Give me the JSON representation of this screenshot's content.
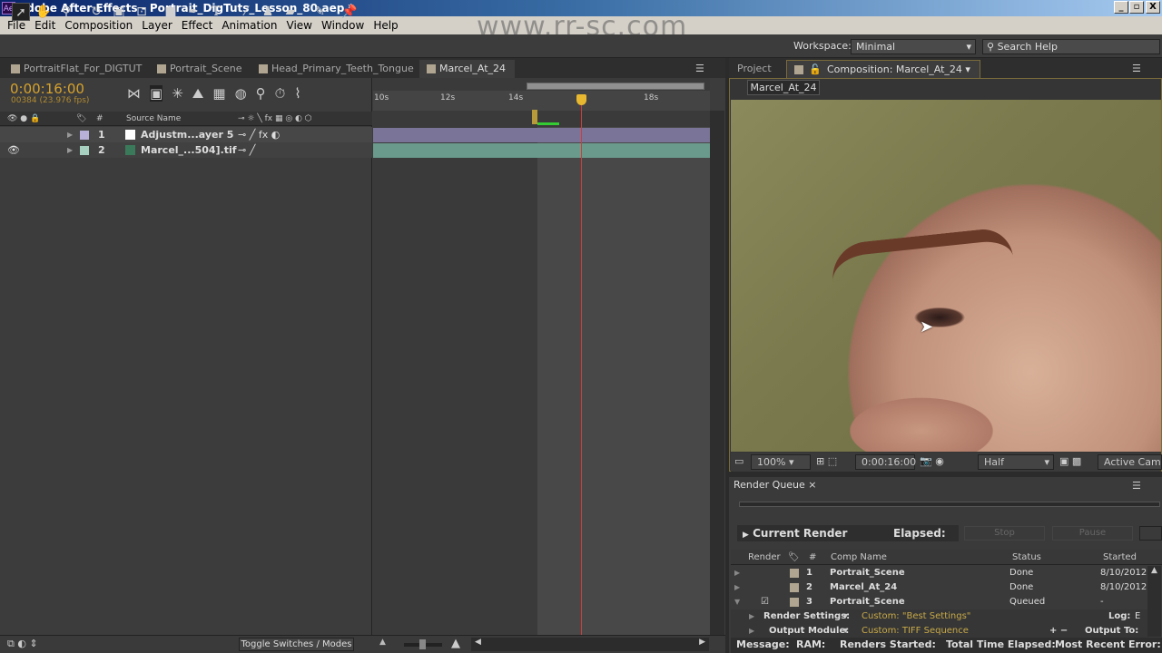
{
  "window": {
    "title": "Adobe After Effects - Portrait_DigTuts_Lesson_80.aep *",
    "logo": "Ae",
    "minimize": "_",
    "restore": "▫",
    "close": "X"
  },
  "menu": [
    "File",
    "Edit",
    "Composition",
    "Layer",
    "Effect",
    "Animation",
    "View",
    "Window",
    "Help"
  ],
  "toolbar": {
    "tools": [
      "selection-tool",
      "hand-tool",
      "zoom-tool",
      "rotate-tool",
      "camera-tool",
      "pan-behind-tool",
      "rectangle-tool",
      "pen-tool",
      "type-tool",
      "brush-tool",
      "clone-stamp-tool",
      "eraser-tool",
      "roto-brush-tool",
      "puppet-pin-tool"
    ],
    "workspace_label": "Workspace:",
    "workspace_value": "Minimal",
    "search_placeholder": "Search Help"
  },
  "watermark": "www.rr-sc.com",
  "timeline": {
    "tabs": [
      "PortraitFlat_For_DIGTUT",
      "Portrait_Scene",
      "Head_Primary_Teeth_Tongue",
      "Marcel_At_24"
    ],
    "active_tab": 3,
    "timecode": "0:00:16:00",
    "frames": "00384 (23.976 fps)",
    "columns": {
      "num": "#",
      "source": "Source Name"
    },
    "ruler": [
      "10s",
      "12s",
      "14s",
      "18s"
    ],
    "layers": [
      {
        "num": "1",
        "name": "Adjustm...ayer 5",
        "color": "#b8b0d8",
        "bar": "#7a7498"
      },
      {
        "num": "2",
        "name": "Marcel_...504].tif",
        "color": "#a8d0c0",
        "bar": "#6a9a8c"
      }
    ],
    "toggle_label": "Toggle Switches / Modes"
  },
  "composition": {
    "project_tab": "Project",
    "tab": "Composition: Marcel_At_24",
    "comp_button": "Marcel_At_24",
    "zoom": "100%",
    "timecode": "0:00:16:00",
    "resolution": "Half",
    "camera": "Active Camer"
  },
  "render_queue": {
    "tab": "Render Queue",
    "current_render": "Current Render",
    "elapsed": "Elapsed:",
    "stop": "Stop",
    "pause": "Pause",
    "headers": {
      "render": "Render",
      "num": "#",
      "comp": "Comp Name",
      "status": "Status",
      "started": "Started"
    },
    "rows": [
      {
        "num": "1",
        "comp": "Portrait_Scene",
        "status": "Done",
        "started": "8/10/2012,",
        "checked": false
      },
      {
        "num": "2",
        "comp": "Marcel_At_24",
        "status": "Done",
        "started": "8/10/2012,",
        "checked": false
      },
      {
        "num": "3",
        "comp": "Portrait_Scene",
        "status": "Queued",
        "started": "-",
        "checked": true
      }
    ],
    "render_settings_label": "Render Settings:",
    "render_settings_value": "Custom: \"Best Settings\"",
    "log_label": "Log:",
    "log_value": "E",
    "output_module_label": "Output Module:",
    "output_module_value": "Custom: TIFF Sequence",
    "output_to_label": "Output To:",
    "status": {
      "message": "Message:",
      "ram": "RAM:",
      "renders_started": "Renders Started:",
      "total_elapsed": "Total Time Elapsed:",
      "recent_error": "Most Recent Error:"
    }
  }
}
